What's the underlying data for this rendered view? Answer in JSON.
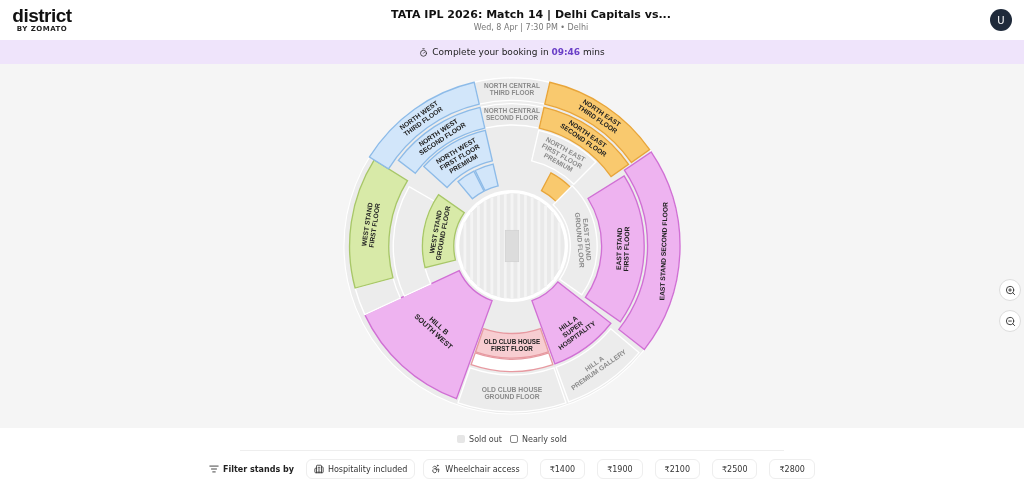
{
  "header": {
    "logo": "district",
    "logo_sub": "BY ZOMATO",
    "title": "TATA IPL 2026: Match 14 | Delhi Capitals vs...",
    "subtitle": "Wed, 8 Apr | 7:30 PM • Delhi",
    "avatar": "U"
  },
  "timer_banner": {
    "text": "Complete your booking in",
    "time": "09:46",
    "unit": "mins"
  },
  "stands": [
    {
      "label": "NORTH CENTRAL THIRD FLOOR",
      "color": "#ececec",
      "sold_out": true
    },
    {
      "label": "NORTH CENTRAL SECOND FLOOR",
      "color": "#ececec",
      "sold_out": true
    },
    {
      "label": "NORTH EAST THIRD FLOOR",
      "color": "#f9c96e",
      "sold_out": false
    },
    {
      "label": "NORTH EAST SECOND FLOOR",
      "color": "#f9c96e",
      "sold_out": false
    },
    {
      "label": "NORTH EAST FIRST FLOOR PREMIUM",
      "color": "#ececec",
      "sold_out": true
    },
    {
      "color": "#f9c96e",
      "sold_out": false
    },
    {
      "label": "EAST STAND SECOND FLOOR",
      "color": "#eeb3f0",
      "sold_out": false
    },
    {
      "label": "EAST STAND FIRST FLOOR",
      "color": "#eeb3f0",
      "sold_out": false
    },
    {
      "label": "EAST STAND GROUND FLOOR",
      "color": "#ececec",
      "sold_out": true
    },
    {
      "label": "HILL A SUPER HOSPITALITY",
      "color": "#eeb3f0",
      "sold_out": false
    },
    {
      "label": "HILL A PREMIUM GALLERY",
      "color": "#ececec",
      "sold_out": true
    },
    {
      "label": "OLD CLUB HOUSE FIRST FLOOR",
      "color": "#f7cdd1",
      "sold_out": false
    },
    {
      "label": "OLD CLUB HOUSE GROUND FLOOR",
      "color": "#ececec",
      "sold_out": true
    },
    {
      "label": "HILL B SOUTH WEST",
      "color": "#eeb3f0",
      "sold_out": false
    },
    {
      "color": "#ececec",
      "sold_out": true
    },
    {
      "label": "WEST STAND FIRST FLOOR",
      "color": "#d8eaa8",
      "sold_out": false
    },
    {
      "color": "#ececec",
      "sold_out": true
    },
    {
      "label": "WEST STAND GROUND FLOOR",
      "color": "#d8eaa8",
      "sold_out": false
    },
    {
      "label": "NORTH WEST THIRD FLOOR",
      "color": "#d2e6fa",
      "sold_out": false
    },
    {
      "label": "NORTH WEST SECOND FLOOR",
      "color": "#d2e6fa",
      "sold_out": false
    },
    {
      "label": "NORTH WEST FIRST FLOOR PREMIUM",
      "color": "#d2e6fa",
      "sold_out": false
    },
    {
      "color": "#d2e6fa",
      "sold_out": false
    },
    {
      "color": "#d2e6fa",
      "sold_out": false
    }
  ],
  "legend": [
    {
      "label": "Sold out",
      "kind": "sold_out"
    },
    {
      "label": "Nearly sold",
      "kind": "nearly_sold"
    }
  ],
  "filter": {
    "label": "Filter stands by",
    "options": [
      {
        "label": "Hospitality included",
        "kind": "hospitality",
        "selected": false
      },
      {
        "label": "Wheelchair access",
        "kind": "wheelchair",
        "selected": false
      },
      {
        "label": "₹1400",
        "kind": "price",
        "selected": false
      },
      {
        "label": "₹1900",
        "kind": "price",
        "selected": false
      },
      {
        "label": "₹2100",
        "kind": "price",
        "selected": false
      },
      {
        "label": "₹2500",
        "kind": "price",
        "selected": false
      },
      {
        "label": "₹2800",
        "kind": "price",
        "selected": false
      }
    ]
  }
}
